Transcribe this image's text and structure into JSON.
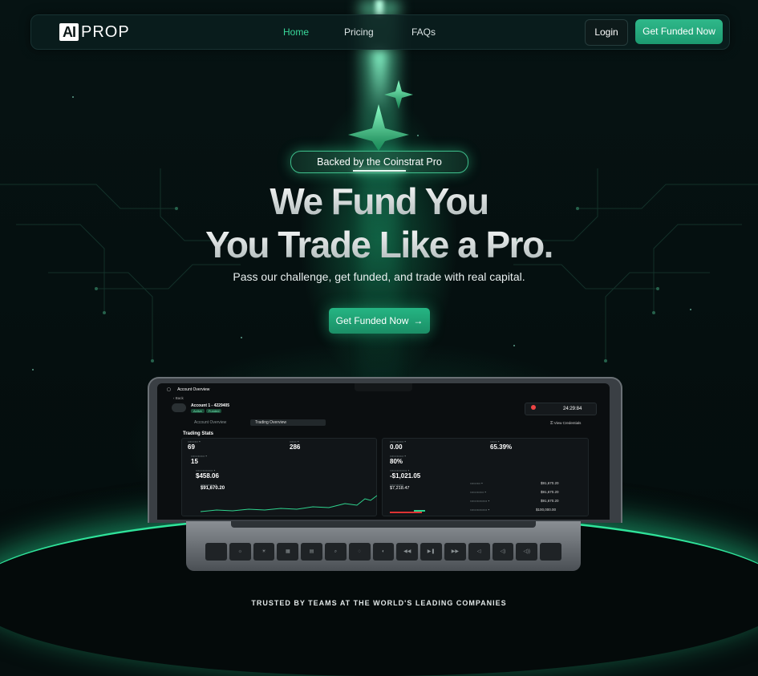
{
  "nav": {
    "logo_ai": "AI",
    "logo_prop": "PROP",
    "links": [
      {
        "label": "Home",
        "active": true
      },
      {
        "label": "Pricing",
        "active": false
      },
      {
        "label": "FAQs",
        "active": false
      }
    ],
    "login_label": "Login",
    "cta_label": "Get Funded Now"
  },
  "hero": {
    "badge": "Backed by the Coinstrat Pro",
    "title_line1": "We Fund You",
    "title_line2": "You Trade Like a Pro.",
    "subtitle": "Pass our challenge, get funded, and trade with real capital.",
    "cta_label": "Get Funded Now",
    "cta_icon": "arrow-right-icon"
  },
  "dashboard": {
    "header": "Account Overview",
    "back": "Back",
    "account_name": "Account 1 - 4229405",
    "tags": [
      "Active",
      "Funded"
    ],
    "timer": "24:29:84",
    "tabs": [
      "Account Overview",
      "Trading Overview"
    ],
    "view_credentials": "View Credentials",
    "section_title": "Trading Stats",
    "stats": [
      {
        "value": "69"
      },
      {
        "value": "286"
      },
      {
        "value": "0.00"
      },
      {
        "value": "65.39%"
      },
      {
        "value": "15"
      },
      {
        "value": "80%"
      },
      {
        "value": "$458.06"
      },
      {
        "value": "-$1,021.05"
      },
      {
        "value": "$91,670.20"
      },
      {
        "value": "$7,218.47"
      }
    ],
    "side_values": [
      "$91,670.20",
      "$91,670.20",
      "$91,670.20",
      "$100,000.00"
    ]
  },
  "footer": {
    "trusted": "TRUSTED BY TEAMS AT THE WORLD'S LEADING COMPANIES"
  },
  "colors": {
    "accent": "#2fb88a",
    "background": "#050e0e",
    "active_link": "#39d79a"
  }
}
